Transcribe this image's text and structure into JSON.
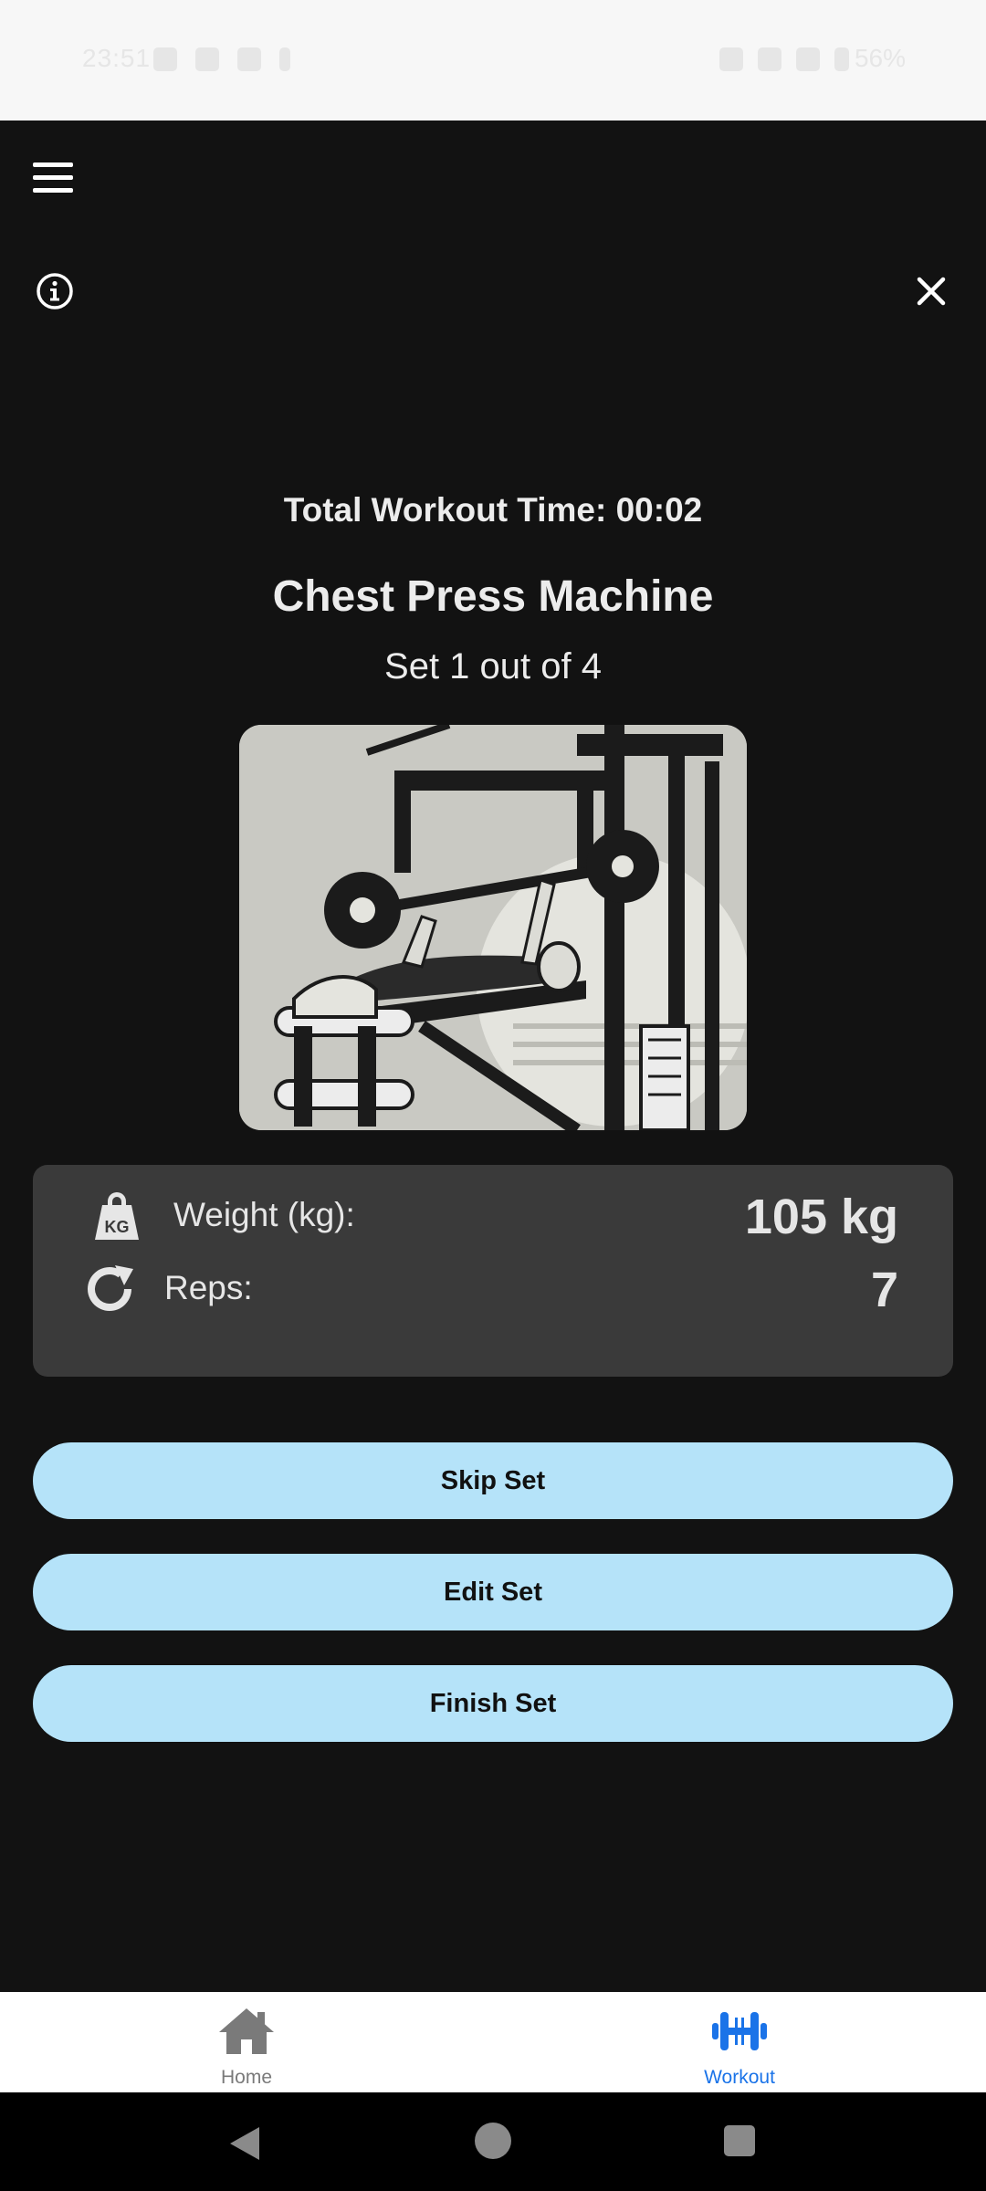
{
  "status_bar": {
    "time": "23:51",
    "battery": "56%"
  },
  "header": {
    "menu_icon": "hamburger-menu-icon",
    "info_icon": "info-icon",
    "close_icon": "close-icon"
  },
  "workout": {
    "total_time": "Total Workout Time: 00:02",
    "exercise_name": "Chest Press Machine",
    "set_progress": "Set 1 out of 4",
    "image_alt": "chest press machine illustration"
  },
  "set_details": {
    "weight_label": "Weight (kg):",
    "weight_value": "105 kg",
    "weight_icon": "kettlebell-kg-icon",
    "reps_label": "Reps:",
    "reps_value": "7",
    "reps_icon": "refresh-icon"
  },
  "actions": {
    "skip_label": "Skip Set",
    "edit_label": "Edit Set",
    "finish_label": "Finish Set"
  },
  "bottom_nav": {
    "items": [
      {
        "label": "Home",
        "icon": "home-icon",
        "active": false
      },
      {
        "label": "Workout",
        "icon": "dumbbell-icon",
        "active": true
      }
    ],
    "active_color": "#1a73e8",
    "inactive_color": "#7a7a7a"
  },
  "colors": {
    "background": "#121212",
    "card": "#3a3a3a",
    "button": "#b5e3f9"
  }
}
